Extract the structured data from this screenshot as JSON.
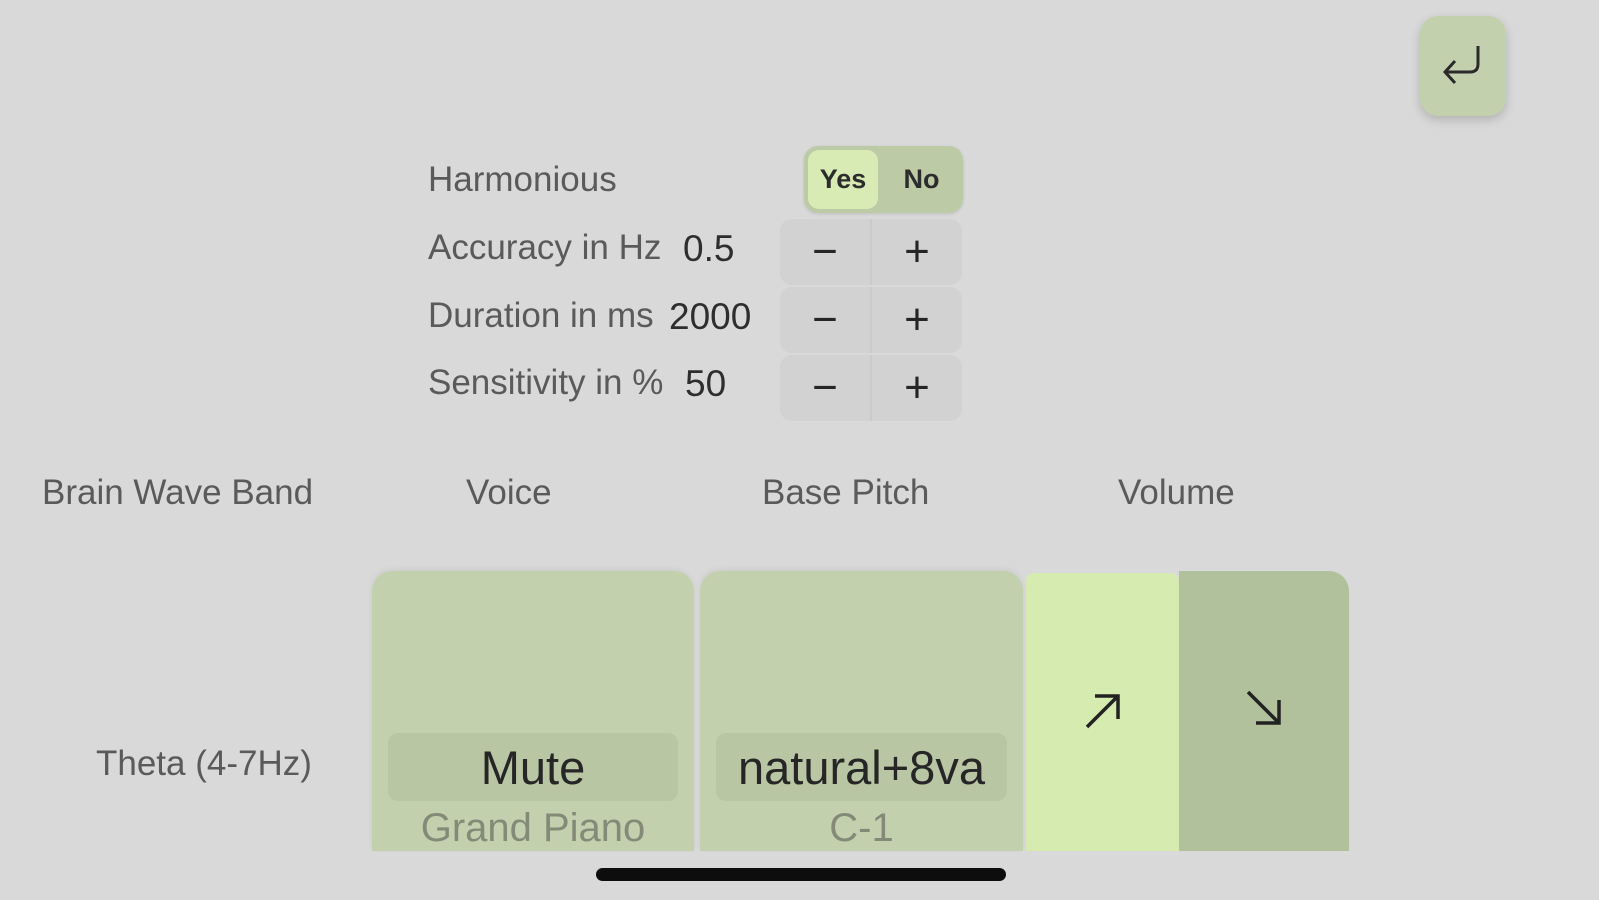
{
  "nav": {
    "back_icon": "return-arrow-icon"
  },
  "settings": {
    "harmonious": {
      "label": "Harmonious",
      "options": [
        "Yes",
        "No"
      ],
      "selected": "Yes"
    },
    "accuracy": {
      "label": "Accuracy in Hz",
      "value": "0.5"
    },
    "duration": {
      "label": "Duration in ms",
      "value": "2000"
    },
    "sensitivity": {
      "label": "Sensitivity in %",
      "value": "50"
    },
    "decrement_symbol": "−",
    "increment_symbol": "+"
  },
  "table": {
    "headers": {
      "band": "Brain Wave Band",
      "voice": "Voice",
      "pitch": "Base Pitch",
      "volume": "Volume"
    },
    "row": {
      "band": "Theta (4-7Hz)",
      "voice": "Mute",
      "voice_sub": "Grand Piano",
      "pitch": "natural+8va",
      "pitch_sub": "C-1",
      "volume_up_icon": "arrow-up-right-icon",
      "volume_down_icon": "arrow-down-right-icon"
    }
  },
  "colors": {
    "background": "#d9d9d9",
    "card": "#c3d0ad",
    "accent_light": "#d6ebb0",
    "accent_dark": "#b1c19c"
  }
}
